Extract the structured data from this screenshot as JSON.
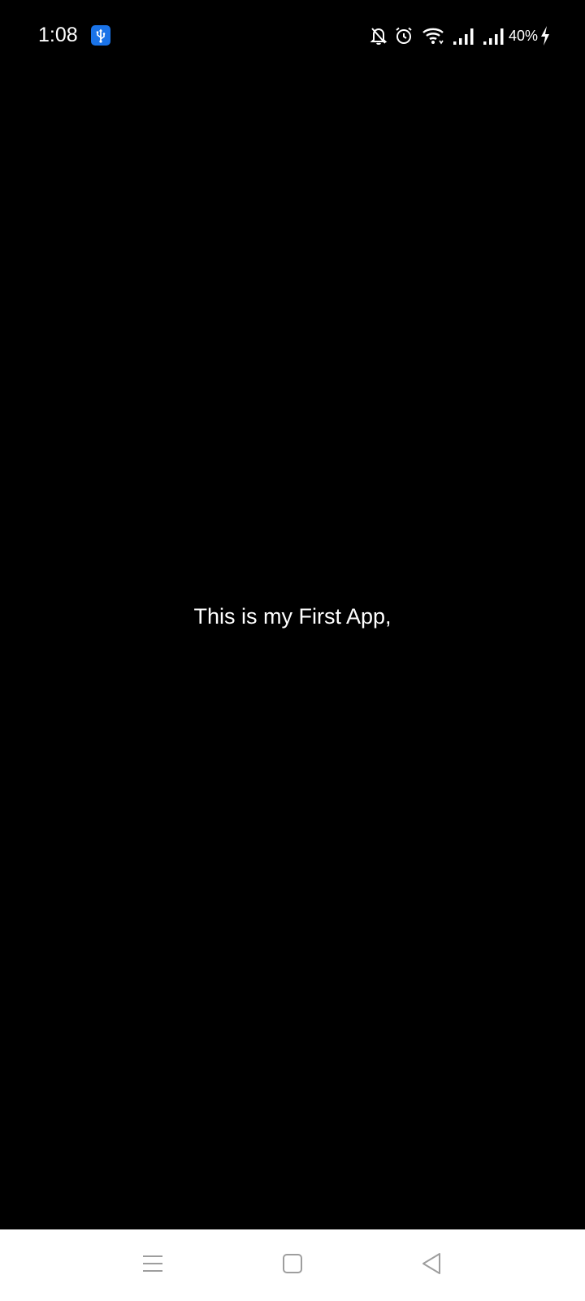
{
  "status_bar": {
    "time": "1:08",
    "battery": "40%",
    "usb_badge_color": "#1a73e8",
    "icons": [
      "usb-debug-icon",
      "bell-off-icon",
      "alarm-icon",
      "wifi-icon",
      "signal-icon",
      "signal-icon",
      "battery-charging-icon"
    ]
  },
  "main": {
    "text": "This is my First App,"
  },
  "nav_bar": {
    "background": "#ffffff",
    "icon_color": "#9e9e9e",
    "buttons": [
      "recent-apps-icon",
      "home-icon",
      "back-icon"
    ]
  }
}
